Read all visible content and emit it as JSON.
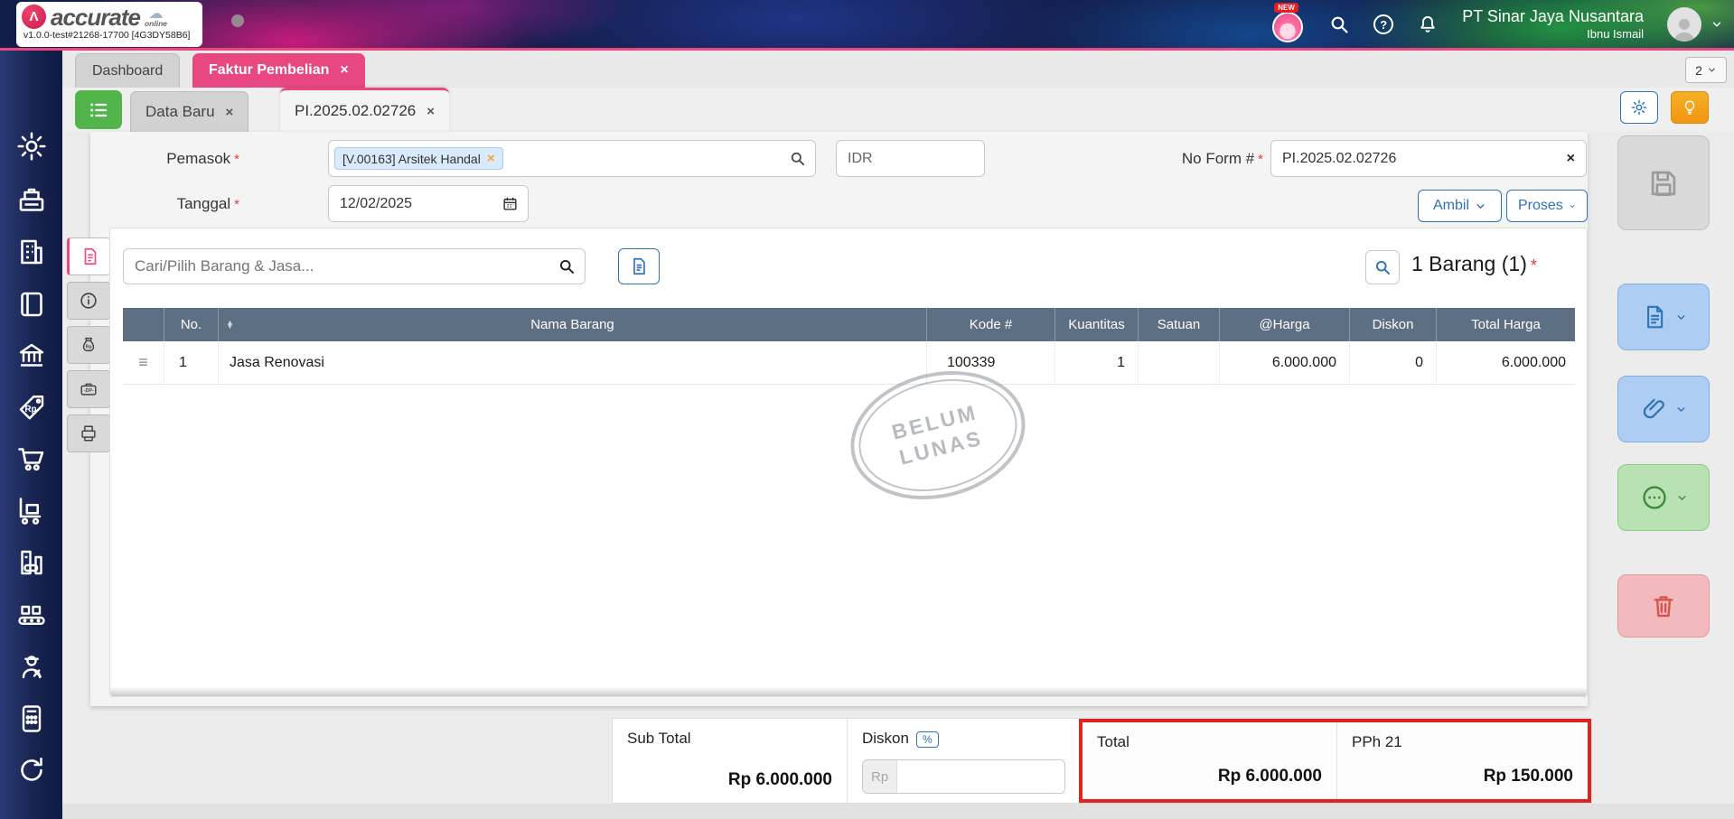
{
  "header": {
    "brand": "accurate",
    "brand_sub": "online",
    "brand_mark": "Λ",
    "version": "v1.0.0-test#21268-17700 [4G3DY58B6]",
    "new_badge": "NEW",
    "company": "PT Sinar Jaya Nusantara",
    "user": "Ibnu Ismail"
  },
  "window_tabs": {
    "dashboard": "Dashboard",
    "faktur": "Faktur Pembelian",
    "overflow_count": "2"
  },
  "doc_tabs": {
    "data_baru": "Data Baru",
    "invoice": "PI.2025.02.02726"
  },
  "form": {
    "pemasok_label": "Pemasok",
    "pemasok_chip": "[V.00163] Arsitek Handal",
    "currency": "IDR",
    "no_form_label": "No Form #",
    "no_form_value": "PI.2025.02.02726",
    "tanggal_label": "Tanggal",
    "tanggal_value": "12/02/2025",
    "ambil": "Ambil",
    "proses": "Proses"
  },
  "items": {
    "search_placeholder": "Cari/Pilih Barang & Jasa...",
    "count": "1 Barang (1)"
  },
  "table": {
    "headers": {
      "no": "No.",
      "nama": "Nama Barang",
      "kode": "Kode #",
      "kuantitas": "Kuantitas",
      "satuan": "Satuan",
      "harga": "@Harga",
      "diskon": "Diskon",
      "total": "Total Harga"
    },
    "rows": [
      {
        "no": "1",
        "nama": "Jasa Renovasi",
        "kode": "100339",
        "kuantitas": "1",
        "satuan": "",
        "harga": "6.000.000",
        "diskon": "0",
        "total": "6.000.000"
      }
    ]
  },
  "watermark": {
    "line1": "BELUM",
    "line2": "LUNAS"
  },
  "totals": {
    "sub_total_label": "Sub Total",
    "sub_total_value": "Rp 6.000.000",
    "diskon_label": "Diskon",
    "diskon_unit": "%",
    "diskon_prefix": "Rp",
    "total_label": "Total",
    "total_value": "Rp 6.000.000",
    "pph_label": "PPh 21",
    "pph_value": "Rp 150.000"
  },
  "misc": {
    "required_mark": "*",
    "close": "×",
    "drag": "≡",
    "sort_up": "▲",
    "sort_down": "▼",
    "cloud": "☁",
    "help": "?"
  },
  "colors": {
    "accent_pink": "#e8487f",
    "sidebar_navy": "#16224e",
    "table_header": "#5d6f83",
    "primary_blue": "#2e73b8",
    "success_green": "#52b54b",
    "highlight_red": "#e0231f",
    "warning_orange": "#f5a81c",
    "chip_blue_bg": "#d9eafc"
  },
  "sidebar_icons": [
    "settings",
    "cash-register",
    "company",
    "journal",
    "banking",
    "sales-tag",
    "purchase-cart",
    "inventory",
    "fixed-asset",
    "manufacture",
    "services",
    "calculator",
    "integration"
  ],
  "side_tabs": [
    "invoice-detail",
    "info",
    "down-payment-money",
    "down-payment-case",
    "documents"
  ]
}
